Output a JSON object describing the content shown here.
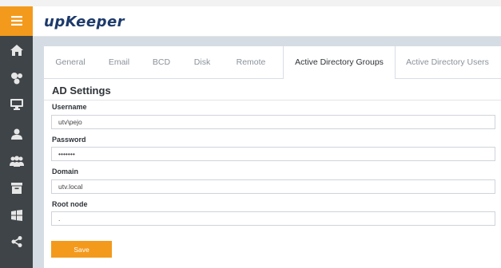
{
  "app": {
    "logo_text": "upKeeper"
  },
  "sidebar": {
    "menu_icon": "hamburger-icon",
    "items": [
      {
        "icon": "home-icon"
      },
      {
        "icon": "apps-icon"
      },
      {
        "icon": "monitor-icon"
      },
      {
        "icon": "user-icon"
      },
      {
        "icon": "users-icon"
      },
      {
        "icon": "archive-icon"
      },
      {
        "icon": "windows-icon"
      },
      {
        "icon": "share-icon"
      }
    ]
  },
  "tabs": [
    {
      "label": "General"
    },
    {
      "label": "Email"
    },
    {
      "label": "BCD"
    },
    {
      "label": "Disk"
    },
    {
      "label": "Remote"
    },
    {
      "label": "Active Directory Groups",
      "active": true
    },
    {
      "label": "Active Directory Users"
    }
  ],
  "form": {
    "title": "AD Settings",
    "username_label": "Username",
    "username_value": "utv\\pejo",
    "password_label": "Password",
    "password_value": "•••••••",
    "domain_label": "Domain",
    "domain_value": "utv.local",
    "rootnode_label": "Root node",
    "rootnode_value": ".",
    "save_label": "Save"
  },
  "colors": {
    "accent": "#f39a1d",
    "sidebar": "#3f4448",
    "logo": "#1d3a6b",
    "content_bg": "#d5dce3"
  }
}
